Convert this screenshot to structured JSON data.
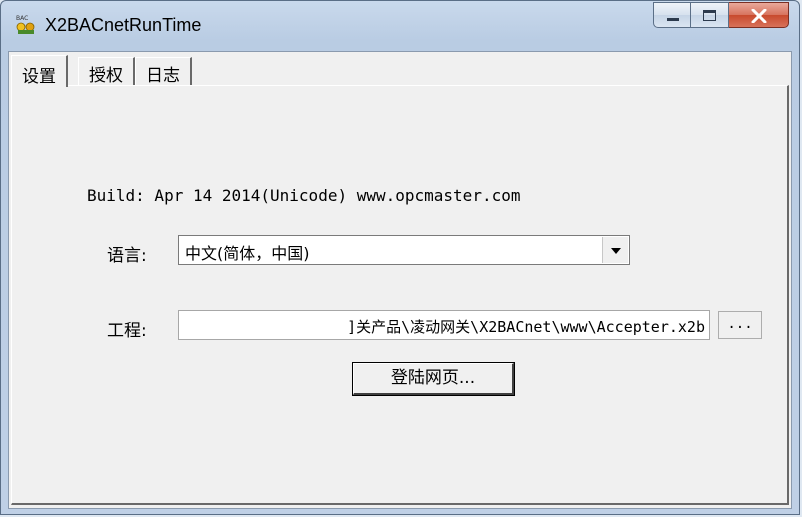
{
  "window": {
    "title": "X2BACnetRunTime",
    "icon": "bac-app-icon",
    "controls": {
      "minimize_icon": "minimize-icon",
      "maximize_icon": "maximize-icon",
      "close_icon": "close-icon",
      "close_color": "#c84a2e"
    }
  },
  "tabs": [
    {
      "label": "设置",
      "active": true
    },
    {
      "label": "授权",
      "active": false
    },
    {
      "label": "日志",
      "active": false
    }
  ],
  "settings": {
    "build_text": "Build: Apr 14 2014(Unicode) www.opcmaster.com",
    "language_label": "语言:",
    "language_value": "中文(简体，中国)",
    "project_label": "工程:",
    "project_path": "]关产品\\凌动网关\\X2BACnet\\www\\Accepter.x2b",
    "browse_label": "...",
    "login_button": "登陆网页..."
  }
}
